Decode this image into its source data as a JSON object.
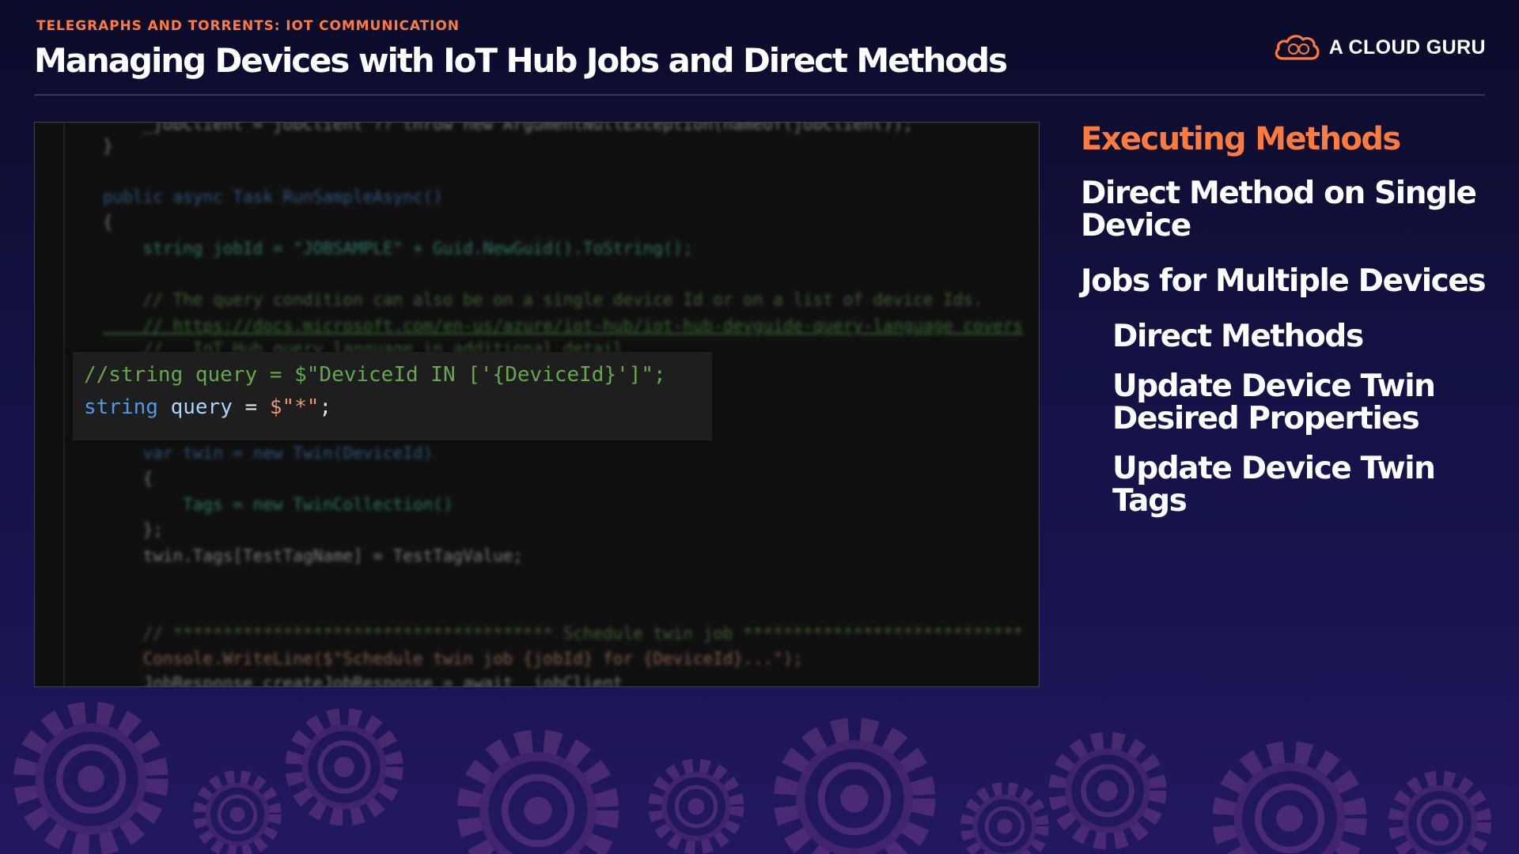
{
  "header": {
    "subtitle": "TELEGRAPHS AND TORRENTS: IOT COMMUNICATION",
    "title": "Managing Devices with IoT Hub Jobs and Direct Methods"
  },
  "logo": {
    "text": "A CLOUD GURU",
    "icon": "cloud-logo-icon",
    "color": "#ff7a3d"
  },
  "code": {
    "lines": [
      "    _jobClient = jobClient ?? throw new ArgumentNullException(nameof(jobClient));",
      "}",
      "",
      "public async Task RunSampleAsync()",
      "{",
      "    string jobId = \"JOBSAMPLE\" + Guid.NewGuid().ToString();",
      "",
      "    // The query condition can also be on a single device Id or on a list of device Ids.",
      "    // https://docs.microsoft.com/en-us/azure/iot-hub/iot-hub-devguide-query-language covers",
      "    //   IoT Hub query language in additional detail.",
      "",
      "",
      "",
      "    var twin = new Twin(DeviceId)",
      "    {",
      "        Tags = new TwinCollection()",
      "    };",
      "    twin.Tags[TestTagName] = TestTagValue;",
      "",
      "",
      "    // ************************************** Schedule twin job ****************************",
      "    Console.WriteLine($\"Schedule twin job {jobId} for {DeviceId}...\");",
      "    JobResponse createJobResponse = await _jobClient"
    ],
    "highlighted": [
      "//string query = $\"DeviceId IN ['{DeviceId}']\";",
      "string query = $\"*\";"
    ]
  },
  "outline": {
    "heading": "Executing Methods",
    "items": [
      {
        "label": "Direct Method on Single Device",
        "level": 1
      },
      {
        "label": "Jobs for Multiple Devices",
        "level": 1
      },
      {
        "label": "Direct Methods",
        "level": 2
      },
      {
        "label": "Update Device Twin Desired Properties",
        "level": 2
      },
      {
        "label": "Update Device Twin Tags",
        "level": 2
      }
    ]
  },
  "colors": {
    "accent": "#ff7a3d",
    "background": "#15134a",
    "gears": "#5b2f7a"
  }
}
